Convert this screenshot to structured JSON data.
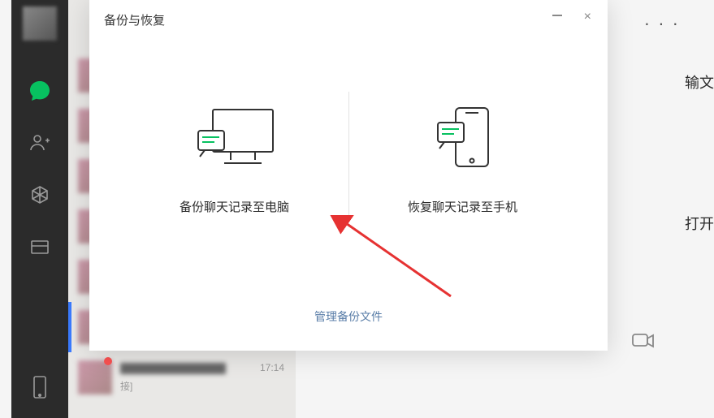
{
  "sidebar": {
    "icons": [
      "chat",
      "contacts",
      "favorites",
      "files",
      "phone"
    ]
  },
  "chat_list": {
    "items": [
      {
        "time": ""
      },
      {
        "time": ""
      },
      {
        "time": ""
      },
      {
        "time": ""
      },
      {
        "time": ""
      },
      {
        "time": ""
      },
      {
        "time": "17:14",
        "name": "",
        "sub": "接]"
      }
    ]
  },
  "right_texts": {
    "t1": "输文",
    "t2": "打开"
  },
  "modal": {
    "title": "备份与恢复",
    "close": "×",
    "backup_label": "备份聊天记录至电脑",
    "restore_label": "恢复聊天记录至手机",
    "manage_link": "管理备份文件"
  }
}
